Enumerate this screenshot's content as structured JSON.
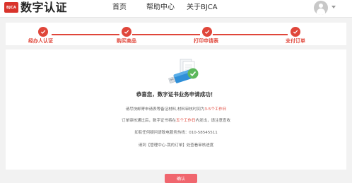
{
  "header": {
    "logo_badge": "BJCA",
    "logo_text": "数字认证",
    "nav": {
      "home": "首页",
      "help": "帮助中心",
      "about": "关于BJCA"
    }
  },
  "steps": [
    {
      "label": "经办人认证"
    },
    {
      "label": "购买商品"
    },
    {
      "label": "打印申请表"
    },
    {
      "label": "支付订单"
    }
  ],
  "main": {
    "title": "恭喜您，数字证书业务申请成功！",
    "info1_prefix": "请尽快邮寄申请表等备证材料,材料审核时间为",
    "info1_highlight": "3-5个工作日",
    "info2_prefix": "订单审核通过后，数字证书将在",
    "info2_highlight": "五个工作日",
    "info2_suffix": "内发出，请注意查收",
    "info3": "如有任何疑问请致电服务热线：010-58545511",
    "info4": "请到【管理中心-我的订单】处查看审核进度",
    "confirm_label": "确认"
  },
  "colors": {
    "accent": "#e0463a",
    "button": "#f0666e",
    "success": "#5cb85c",
    "usb": "#2f8fd8"
  }
}
